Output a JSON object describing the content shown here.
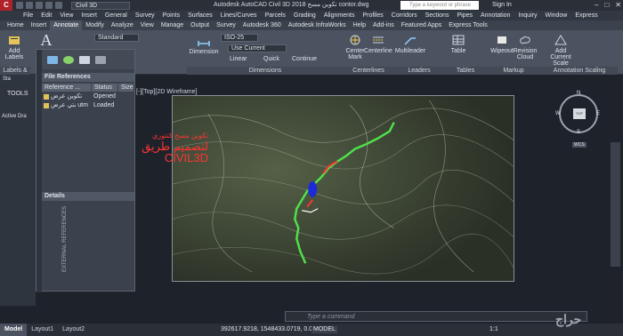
{
  "titlebar": {
    "workspace": "Civil 3D",
    "document_title": "Autodesk AutoCAD Civil 3D 2018   تكوين مسح contor.dwg",
    "search_placeholder": "Type a keyword or phrase",
    "signin": "Sign In"
  },
  "menu": [
    "File",
    "Edit",
    "View",
    "Insert",
    "General",
    "Survey",
    "Points",
    "Surfaces",
    "Lines/Curves",
    "Parcels",
    "Grading",
    "Alignments",
    "Profiles",
    "Corridors",
    "Sections",
    "Pipes",
    "Annotation",
    "Inquiry",
    "Window",
    "Express"
  ],
  "tabs": [
    {
      "label": "Home",
      "active": false
    },
    {
      "label": "Insert",
      "active": false
    },
    {
      "label": "Annotate",
      "active": true
    },
    {
      "label": "Modify",
      "active": false
    },
    {
      "label": "Analyze",
      "active": false
    },
    {
      "label": "View",
      "active": false
    },
    {
      "label": "Manage",
      "active": false
    },
    {
      "label": "Output",
      "active": false
    },
    {
      "label": "Survey",
      "active": false
    },
    {
      "label": "Autodesk 360",
      "active": false
    },
    {
      "label": "Autodesk InfraWorks",
      "active": false
    },
    {
      "label": "Help",
      "active": false
    },
    {
      "label": "Add-ins",
      "active": false
    },
    {
      "label": "Featured Apps",
      "active": false
    },
    {
      "label": "Express Tools",
      "active": false
    }
  ],
  "ribbon": {
    "add_labels": "Add Labels",
    "labels_panel": "Labels &",
    "text_style": "Standard",
    "dim_style": "ISO-25",
    "dimension": "Dimension",
    "use_current": "Use Current",
    "linear": "Linear",
    "quick": "Quick",
    "continue": "Continue",
    "dimensions_panel": "Dimensions",
    "center_mark": "Center Mark",
    "centerline": "Centerline",
    "centerlines_panel": "Centerlines",
    "multileader": "Multileader",
    "leaders_panel": "Leaders",
    "table": "Table",
    "tables_panel": "Tables",
    "wipeout": "Wipeout",
    "revision_cloud": "Revision Cloud",
    "markup_panel": "Markup",
    "add_current_scale": "Add Current Scale",
    "annotation_scaling_panel": "Annotation Scaling"
  },
  "palette": {
    "file_references": "File References",
    "col_reference": "Reference ...",
    "col_status": "Status",
    "col_size": "Size",
    "rows": [
      {
        "name": "تكوين عرض",
        "status": "Opened"
      },
      {
        "name": "بتي عرض utm",
        "status": "Loaded"
      }
    ],
    "details": "Details",
    "vertical_title": "EXTERNAL REFERENCES"
  },
  "left_tools": {
    "tools": "TOOLS",
    "active_drawing": "Active Dra",
    "start": "Sta"
  },
  "viewport": {
    "label": "[-][Top][2D Wireframe]",
    "overlay_line1": "تكوين مسح كنتوري",
    "overlay_line2": "لتصميم طريق CIVIL3D",
    "navcube_top": "TOP",
    "wcs": "WCS"
  },
  "command": {
    "placeholder": "Type a command"
  },
  "status": {
    "tabs": [
      {
        "label": "Model",
        "active": true
      },
      {
        "label": "Layout1",
        "active": false
      },
      {
        "label": "Layout2",
        "active": false
      }
    ],
    "coordinates": "392617.9218, 1548433.0719, 0.0000",
    "model": "MODEL",
    "scale": "1:1"
  },
  "watermark": "حراج",
  "colors": {
    "accent_red": "#ff3333",
    "profile_green": "#4fe04a"
  }
}
